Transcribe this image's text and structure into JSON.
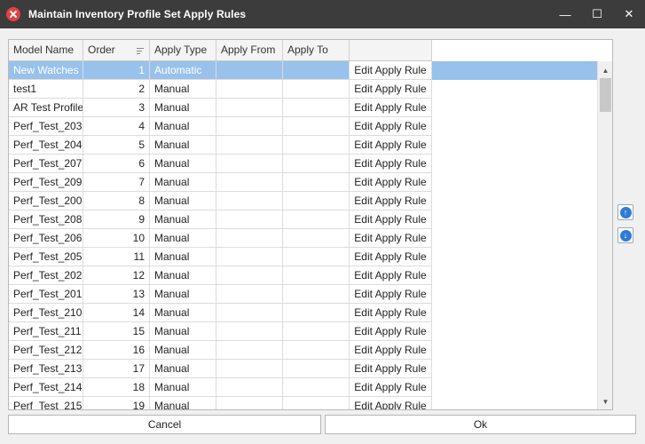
{
  "window": {
    "title": "Maintain Inventory Profile Set Apply Rules",
    "minimize_glyph": "—",
    "maximize_glyph": "☐",
    "close_glyph": "✕"
  },
  "grid": {
    "columns": [
      "Model Name",
      "Order",
      "Apply Type",
      "Apply From",
      "Apply To",
      ""
    ],
    "sorted_column": "Order",
    "selected_row": 0,
    "rows": [
      {
        "model": "New Watches",
        "order": "1",
        "type": "Automatic",
        "from": "",
        "to": "",
        "action": "Edit Apply Rule"
      },
      {
        "model": "test1",
        "order": "2",
        "type": "Manual",
        "from": "",
        "to": "",
        "action": "Edit Apply Rule"
      },
      {
        "model": "AR Test Profile",
        "order": "3",
        "type": "Manual",
        "from": "",
        "to": "",
        "action": "Edit Apply Rule"
      },
      {
        "model": "Perf_Test_203",
        "order": "4",
        "type": "Manual",
        "from": "",
        "to": "",
        "action": "Edit Apply Rule"
      },
      {
        "model": "Perf_Test_204",
        "order": "5",
        "type": "Manual",
        "from": "",
        "to": "",
        "action": "Edit Apply Rule"
      },
      {
        "model": "Perf_Test_207",
        "order": "6",
        "type": "Manual",
        "from": "",
        "to": "",
        "action": "Edit Apply Rule"
      },
      {
        "model": "Perf_Test_209",
        "order": "7",
        "type": "Manual",
        "from": "",
        "to": "",
        "action": "Edit Apply Rule"
      },
      {
        "model": "Perf_Test_200",
        "order": "8",
        "type": "Manual",
        "from": "",
        "to": "",
        "action": "Edit Apply Rule"
      },
      {
        "model": "Perf_Test_208",
        "order": "9",
        "type": "Manual",
        "from": "",
        "to": "",
        "action": "Edit Apply Rule"
      },
      {
        "model": "Perf_Test_206",
        "order": "10",
        "type": "Manual",
        "from": "",
        "to": "",
        "action": "Edit Apply Rule"
      },
      {
        "model": "Perf_Test_205",
        "order": "11",
        "type": "Manual",
        "from": "",
        "to": "",
        "action": "Edit Apply Rule"
      },
      {
        "model": "Perf_Test_202",
        "order": "12",
        "type": "Manual",
        "from": "",
        "to": "",
        "action": "Edit Apply Rule"
      },
      {
        "model": "Perf_Test_201",
        "order": "13",
        "type": "Manual",
        "from": "",
        "to": "",
        "action": "Edit Apply Rule"
      },
      {
        "model": "Perf_Test_210",
        "order": "14",
        "type": "Manual",
        "from": "",
        "to": "",
        "action": "Edit Apply Rule"
      },
      {
        "model": "Perf_Test_211",
        "order": "15",
        "type": "Manual",
        "from": "",
        "to": "",
        "action": "Edit Apply Rule"
      },
      {
        "model": "Perf_Test_212",
        "order": "16",
        "type": "Manual",
        "from": "",
        "to": "",
        "action": "Edit Apply Rule"
      },
      {
        "model": "Perf_Test_213",
        "order": "17",
        "type": "Manual",
        "from": "",
        "to": "",
        "action": "Edit Apply Rule"
      },
      {
        "model": "Perf_Test_214",
        "order": "18",
        "type": "Manual",
        "from": "",
        "to": "",
        "action": "Edit Apply Rule"
      },
      {
        "model": "Perf_Test_215",
        "order": "19",
        "type": "Manual",
        "from": "",
        "to": "",
        "action": "Edit Apply Rule"
      }
    ]
  },
  "scrollbar": {
    "up_glyph": "▲",
    "down_glyph": "▼"
  },
  "reorder": {
    "up_icon": "arrow-up-circle-icon",
    "down_icon": "arrow-down-circle-icon",
    "up_glyph": "↑",
    "down_glyph": "↓"
  },
  "footer": {
    "cancel_label": "Cancel",
    "ok_label": "Ok"
  },
  "colors": {
    "title_bar": "#3c3c3c",
    "selection": "#98c1eb",
    "reorder_accent": "#2f7bd6",
    "app_icon": "#e34141"
  }
}
